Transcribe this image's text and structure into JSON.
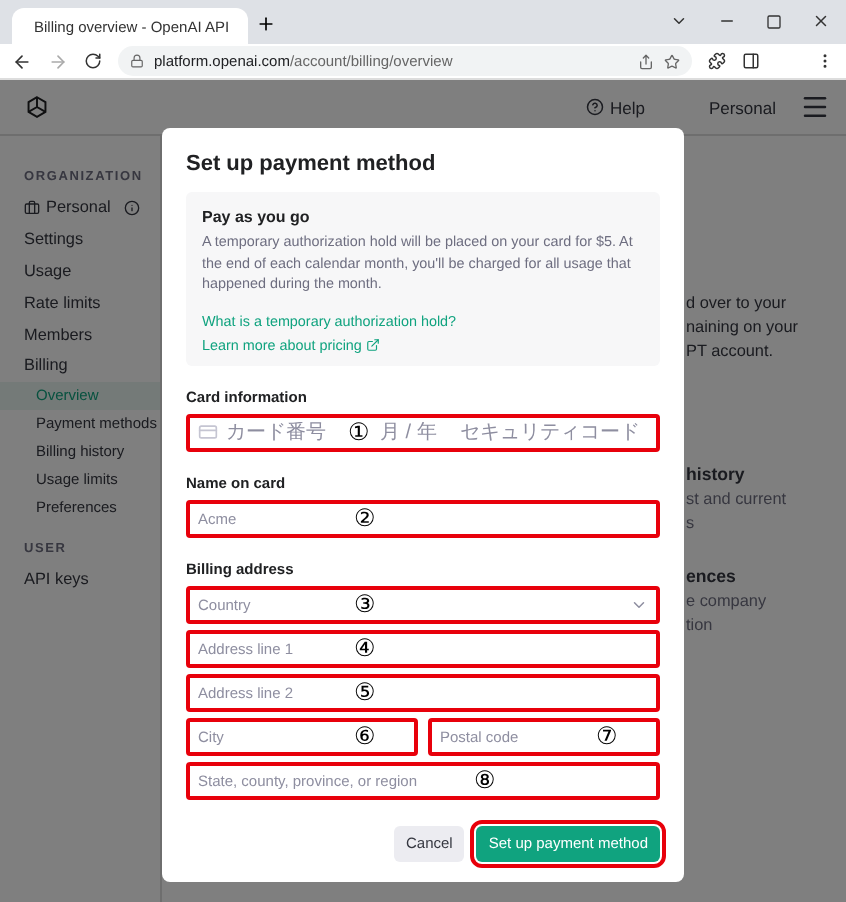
{
  "browser": {
    "tab_title": "Billing overview - OpenAI API",
    "url_host": "platform.openai.com",
    "url_path": "/account/billing/overview"
  },
  "header": {
    "help": "Help",
    "account": "Personal"
  },
  "sidebar": {
    "sections": [
      {
        "heading": "ORGANIZATION",
        "items": [
          {
            "label": "Personal",
            "kind": "org",
            "selected": false
          },
          {
            "label": "Settings",
            "kind": "link",
            "selected": false
          },
          {
            "label": "Usage",
            "kind": "link",
            "selected": false
          },
          {
            "label": "Rate limits",
            "kind": "link",
            "selected": false
          },
          {
            "label": "Members",
            "kind": "link",
            "selected": false
          },
          {
            "label": "Billing",
            "kind": "link",
            "selected": false,
            "children": [
              {
                "label": "Overview",
                "kind": "link",
                "selected": true
              },
              {
                "label": "Payment methods",
                "kind": "link",
                "selected": false
              },
              {
                "label": "Billing history",
                "kind": "link",
                "selected": false
              },
              {
                "label": "Usage limits",
                "kind": "link",
                "selected": false
              },
              {
                "label": "Preferences",
                "kind": "link",
                "selected": false
              }
            ]
          }
        ]
      },
      {
        "heading": "USER",
        "items": [
          {
            "label": "API keys",
            "kind": "link",
            "selected": false
          }
        ]
      }
    ]
  },
  "background_groups": [
    {
      "lines": [
        "d over to your",
        "naining on your",
        "PT account."
      ]
    },
    {
      "heading": "history",
      "lines": [
        "st and current",
        "s"
      ]
    },
    {
      "heading": "ences",
      "lines": [
        "e company",
        "tion"
      ]
    }
  ],
  "modal": {
    "title": "Set up payment method",
    "info": {
      "title": "Pay as you go",
      "body": "A temporary authorization hold will be placed on your card for $5. At the end of each calendar month, you'll be charged for all usage that happened during the month.",
      "links": [
        {
          "text": "What is a temporary authorization hold?",
          "external": false
        },
        {
          "text": "Learn more about pricing",
          "external": true
        }
      ]
    },
    "sections": [
      {
        "label": "Card information",
        "rows": [
          [
            {
              "kind": "card",
              "placeholders": [
                "カード番号",
                "月 / 年",
                "セキュリティコード"
              ],
              "marker": "①",
              "highlighted": true
            }
          ]
        ]
      },
      {
        "label": "Name on card",
        "rows": [
          [
            {
              "kind": "text",
              "placeholder": "Acme",
              "marker": "②",
              "highlighted": true
            }
          ]
        ]
      },
      {
        "label": "Billing address",
        "rows": [
          [
            {
              "kind": "select",
              "placeholder": "Country",
              "marker": "③",
              "highlighted": true
            }
          ],
          [
            {
              "kind": "text",
              "placeholder": "Address line 1",
              "marker": "④",
              "highlighted": true
            }
          ],
          [
            {
              "kind": "text",
              "placeholder": "Address line 2",
              "marker": "⑤",
              "highlighted": true
            }
          ],
          [
            {
              "kind": "text",
              "placeholder": "City",
              "marker": "⑥",
              "highlighted": true
            },
            {
              "kind": "text",
              "placeholder": "Postal code",
              "marker": "⑦",
              "highlighted": true
            }
          ],
          [
            {
              "kind": "text",
              "placeholder": "State, county, province, or region",
              "marker": "⑧",
              "highlighted": true
            }
          ]
        ]
      }
    ],
    "buttons": [
      {
        "label": "Cancel",
        "kind": "secondary",
        "highlighted": false
      },
      {
        "label": "Set up payment method",
        "kind": "primary",
        "highlighted": true
      }
    ]
  }
}
